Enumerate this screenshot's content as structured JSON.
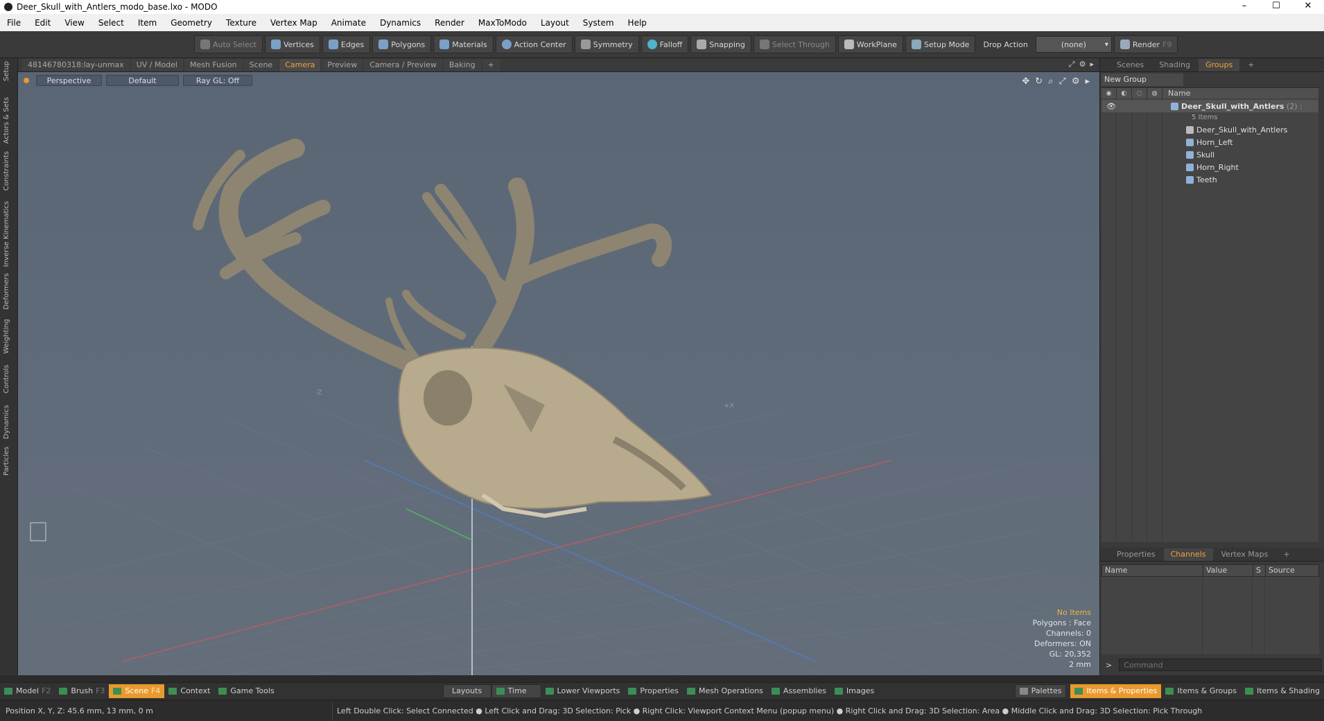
{
  "window": {
    "title": "Deer_Skull_with_Antlers_modo_base.lxo - MODO",
    "minimize": "–",
    "maximize": "☐",
    "close": "✕"
  },
  "menu": [
    "File",
    "Edit",
    "View",
    "Select",
    "Item",
    "Geometry",
    "Texture",
    "Vertex Map",
    "Animate",
    "Dynamics",
    "Render",
    "MaxToModo",
    "Layout",
    "System",
    "Help"
  ],
  "toolbar": {
    "auto_select": "Auto Select",
    "vertices": "Vertices",
    "edges": "Edges",
    "polygons": "Polygons",
    "materials": "Materials",
    "action_center": "Action Center",
    "symmetry": "Symmetry",
    "falloff": "Falloff",
    "snapping": "Snapping",
    "select_through": "Select Through",
    "workplane": "WorkPlane",
    "setup_mode": "Setup Mode",
    "drop_action": "Drop Action",
    "drop_value": "(none)",
    "render": "Render",
    "render_key": "F9"
  },
  "left_tabs": [
    "Setup",
    "Actors & Sets",
    "Constraints",
    "Inverse Kinematics",
    "Deformers",
    "Weighting",
    "Controls",
    "Dynamics",
    "Particles"
  ],
  "viewport_tabs": [
    "48146780318:lay-unmax",
    "UV / Model",
    "Mesh Fusion",
    "Scene",
    "Camera",
    "Preview",
    "Camera / Preview",
    "Baking",
    "+"
  ],
  "viewport": {
    "perspective": "Perspective",
    "shading": "Default",
    "raygl": "Ray GL: Off",
    "axis_z": "-Z",
    "axis_x": "+X"
  },
  "vp_info": {
    "items": "No Items",
    "polygons": "Polygons : Face",
    "channels": "Channels: 0",
    "deformers": "Deformers: ON",
    "gl": "GL: 20,352",
    "scale": "2 mm"
  },
  "right_tabs": [
    "Scenes",
    "Shading",
    "Groups",
    "+"
  ],
  "groups": {
    "new_group": "New Group",
    "col_name": "Name",
    "root": {
      "name": "Deer_Skull_with_Antlers",
      "count": "(2) :",
      "items_count": "5 Items"
    },
    "children": [
      "Deer_Skull_with_Antlers",
      "Horn_Left",
      "Skull",
      "Horn_Right",
      "Teeth"
    ]
  },
  "props_tabs": [
    "Properties",
    "Channels",
    "Vertex Maps",
    "+"
  ],
  "channels_cols": [
    "Name",
    "Value",
    "S",
    "Source"
  ],
  "command": {
    "placeholder": "Command",
    "prompt": ">"
  },
  "bottom": {
    "model": "Model",
    "model_key": "F2",
    "brush": "Brush",
    "brush_key": "F3",
    "scene": "Scene",
    "scene_key": "F4",
    "context": "Context",
    "game_tools": "Game Tools",
    "layouts": "Layouts",
    "time": "Time",
    "lower_viewports": "Lower Viewports",
    "properties": "Properties",
    "mesh_operations": "Mesh Operations",
    "assemblies": "Assemblies",
    "images": "Images",
    "palettes": "Palettes",
    "items_properties": "Items & Properties",
    "items_groups": "Items & Groups",
    "items_shading": "Items & Shading"
  },
  "status": {
    "position": "Position X, Y, Z:  45.6 mm, 13 mm, 0 m",
    "hint": "Left Double Click: Select Connected ● Left Click and Drag: 3D Selection: Pick ● Right Click: Viewport Context Menu (popup menu) ● Right Click and Drag: 3D Selection: Area ● Middle Click and Drag: 3D Selection: Pick Through"
  }
}
